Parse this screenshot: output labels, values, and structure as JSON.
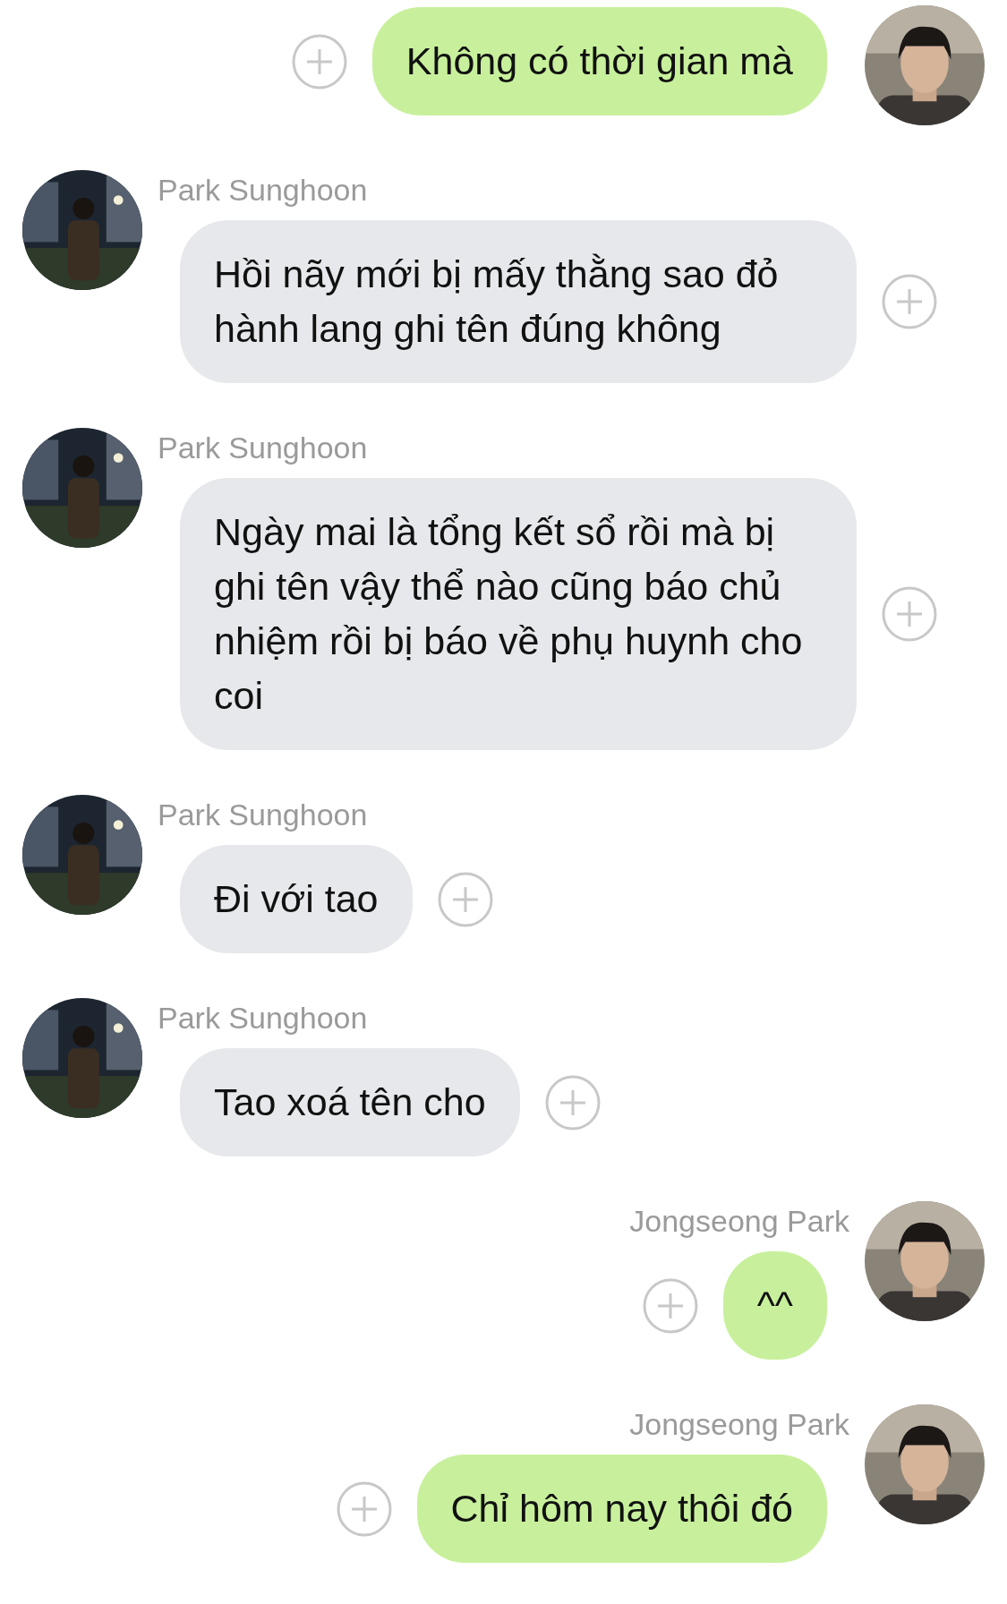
{
  "messages": [
    {
      "kind": "sent",
      "text": "Không có thời gian mà"
    },
    {
      "kind": "received",
      "sender": "Park Sunghoon",
      "text": "Hồi nãy mới bị mấy thằng sao đỏ hành lang ghi tên đúng không"
    },
    {
      "kind": "received",
      "sender": "Park Sunghoon",
      "text": "Ngày mai là tổng kết sổ rồi mà bị ghi tên vậy thể nào cũng báo chủ nhiệm rồi bị báo về phụ huynh cho coi"
    },
    {
      "kind": "received",
      "sender": "Park Sunghoon",
      "text": "Đi với tao"
    },
    {
      "kind": "received",
      "sender": "Park Sunghoon",
      "text": "Tao xoá tên cho"
    },
    {
      "kind": "sent",
      "sender": "Jongseong Park",
      "text": "^^"
    },
    {
      "kind": "sent",
      "sender": "Jongseong Park",
      "text": "Chỉ hôm nay thôi đó"
    }
  ]
}
